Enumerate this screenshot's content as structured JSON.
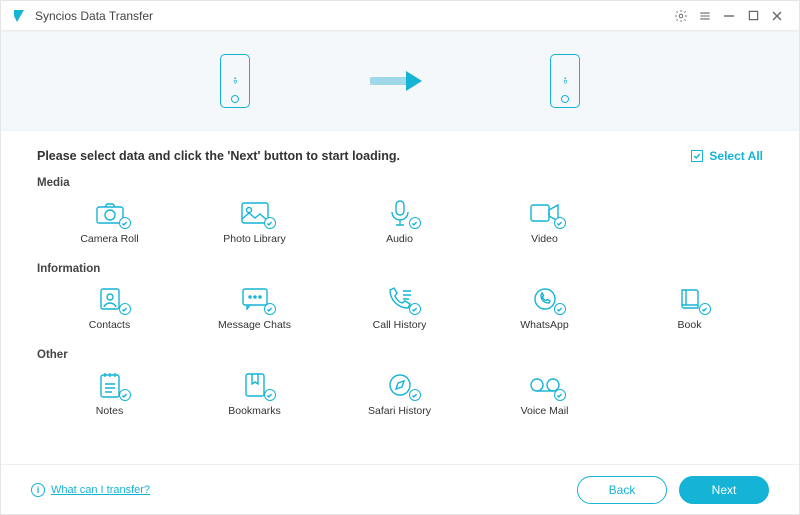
{
  "app": {
    "title": "Syncios Data Transfer"
  },
  "instruction": "Please select data and click the 'Next' button to start loading.",
  "selectAll": {
    "label": "Select All",
    "checked": true
  },
  "sections": {
    "media": {
      "title": "Media",
      "items": [
        {
          "label": "Camera Roll",
          "icon": "camera-icon"
        },
        {
          "label": "Photo Library",
          "icon": "photo-icon"
        },
        {
          "label": "Audio",
          "icon": "audio-icon"
        },
        {
          "label": "Video",
          "icon": "video-icon"
        }
      ]
    },
    "information": {
      "title": "Information",
      "items": [
        {
          "label": "Contacts",
          "icon": "contacts-icon"
        },
        {
          "label": "Message Chats",
          "icon": "message-icon"
        },
        {
          "label": "Call History",
          "icon": "callhistory-icon"
        },
        {
          "label": "WhatsApp",
          "icon": "whatsapp-icon"
        },
        {
          "label": "Book",
          "icon": "book-icon"
        }
      ]
    },
    "other": {
      "title": "Other",
      "items": [
        {
          "label": "Notes",
          "icon": "notes-icon"
        },
        {
          "label": "Bookmarks",
          "icon": "bookmarks-icon"
        },
        {
          "label": "Safari History",
          "icon": "safari-icon"
        },
        {
          "label": "Voice Mail",
          "icon": "voicemail-icon"
        }
      ]
    }
  },
  "footer": {
    "help": "What can I transfer?",
    "back": "Back",
    "next": "Next"
  }
}
